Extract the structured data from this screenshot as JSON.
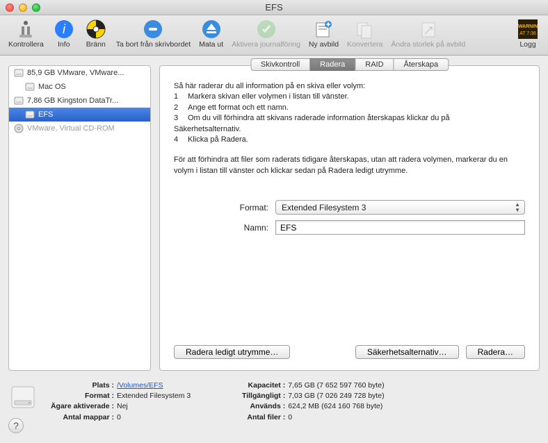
{
  "window": {
    "title": "EFS"
  },
  "toolbar": [
    {
      "id": "verify",
      "label": "Kontrollera",
      "enabled": true
    },
    {
      "id": "info",
      "label": "Info",
      "enabled": true
    },
    {
      "id": "burn",
      "label": "Bränn",
      "enabled": true
    },
    {
      "id": "unmount",
      "label": "Ta bort från skrivbordet",
      "enabled": true
    },
    {
      "id": "eject",
      "label": "Mata ut",
      "enabled": true
    },
    {
      "id": "journal",
      "label": "Aktivera journalföring",
      "enabled": false
    },
    {
      "id": "newimage",
      "label": "Ny avbild",
      "enabled": true
    },
    {
      "id": "convert",
      "label": "Konvertera",
      "enabled": false
    },
    {
      "id": "resize",
      "label": "Ändra storlek på avbild",
      "enabled": false
    },
    {
      "id": "log",
      "label": "Logg",
      "enabled": true
    }
  ],
  "sidebar": [
    {
      "label": "85,9 GB VMware, VMware...",
      "icon": "hdd",
      "child": false,
      "selected": false
    },
    {
      "label": "Mac OS",
      "icon": "hdd",
      "child": true,
      "selected": false
    },
    {
      "label": "7,86 GB Kingston DataTr...",
      "icon": "hdd",
      "child": false,
      "selected": false
    },
    {
      "label": "EFS",
      "icon": "hdd",
      "child": true,
      "selected": true
    },
    {
      "label": "VMware, Virtual CD-ROM",
      "icon": "cd",
      "child": false,
      "selected": false,
      "dim": true
    }
  ],
  "tabs": [
    {
      "id": "firstaid",
      "label": "Skivkontroll",
      "active": false
    },
    {
      "id": "erase",
      "label": "Radera",
      "active": true
    },
    {
      "id": "raid",
      "label": "RAID",
      "active": false
    },
    {
      "id": "restore",
      "label": "Återskapa",
      "active": false
    }
  ],
  "instructions": {
    "intro": "Så här raderar du all information på en skiva eller volym:",
    "steps": [
      "Markera skivan eller volymen i listan till vänster.",
      "Ange ett format och ett namn.",
      "Om du vill förhindra att skivans raderade information återskapas klickar du på Säkerhetsalternativ.",
      "Klicka på Radera."
    ],
    "footer": "För att förhindra att filer som raderats tidigare återskapas, utan att radera volymen, markerar du en volym i listan till vänster och klickar sedan på Radera ledigt utrymme."
  },
  "form": {
    "format_label": "Format:",
    "format_value": "Extended Filesystem 3",
    "name_label": "Namn:",
    "name_value": "EFS"
  },
  "buttons": {
    "erase_free": "Radera ledigt utrymme…",
    "security": "Säkerhetsalternativ…",
    "erase": "Radera…"
  },
  "info": {
    "left": [
      {
        "k": "Plats :",
        "v": "/Volumes/EFS",
        "link": true
      },
      {
        "k": "Format :",
        "v": "Extended Filesystem 3"
      },
      {
        "k": "Ägare aktiverade :",
        "v": "Nej"
      },
      {
        "k": "Antal mappar :",
        "v": "0"
      }
    ],
    "right": [
      {
        "k": "Kapacitet :",
        "v": "7,65 GB (7 652 597 760 byte)"
      },
      {
        "k": "Tillgängligt :",
        "v": "7,03 GB (7 026 249 728 byte)"
      },
      {
        "k": "Används :",
        "v": "624,2 MB (624 160 768 byte)"
      },
      {
        "k": "Antal filer :",
        "v": "0"
      }
    ]
  }
}
